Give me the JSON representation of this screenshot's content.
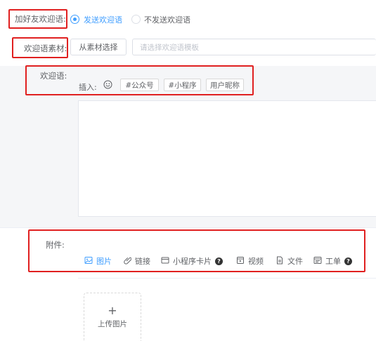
{
  "form": {
    "welcome_switch": {
      "label": "加好友欢迎语",
      "colon": ":",
      "options": [
        {
          "label": "发送欢迎语",
          "checked": true
        },
        {
          "label": "不发送欢迎语",
          "checked": false
        }
      ]
    },
    "material": {
      "label": "欢迎语素材:",
      "button": "从素材选择",
      "placeholder": "请选择欢迎语模板"
    },
    "greeting": {
      "label": "欢迎语:",
      "insert_label": "插入:",
      "emoji_icon": "smile-icon",
      "tags": [
        "#公众号",
        "#小程序",
        "用户昵称"
      ]
    },
    "attachment": {
      "label": "附件:",
      "tools": [
        {
          "label": "图片",
          "icon": "image-icon",
          "active": true,
          "help": false
        },
        {
          "label": "链接",
          "icon": "link-icon",
          "active": false,
          "help": false
        },
        {
          "label": "小程序卡片",
          "icon": "miniprogram-card-icon",
          "active": false,
          "help": true
        },
        {
          "label": "视频",
          "icon": "video-icon",
          "active": false,
          "help": false
        },
        {
          "label": "文件",
          "icon": "file-icon",
          "active": false,
          "help": false
        },
        {
          "label": "工单",
          "icon": "ticket-icon",
          "active": false,
          "help": true
        }
      ],
      "upload": {
        "plus": "+",
        "label": "上传图片"
      }
    }
  },
  "colors": {
    "accent": "#409eff",
    "highlight_box": "#e02020",
    "panel_bg": "#f5f6f8"
  }
}
